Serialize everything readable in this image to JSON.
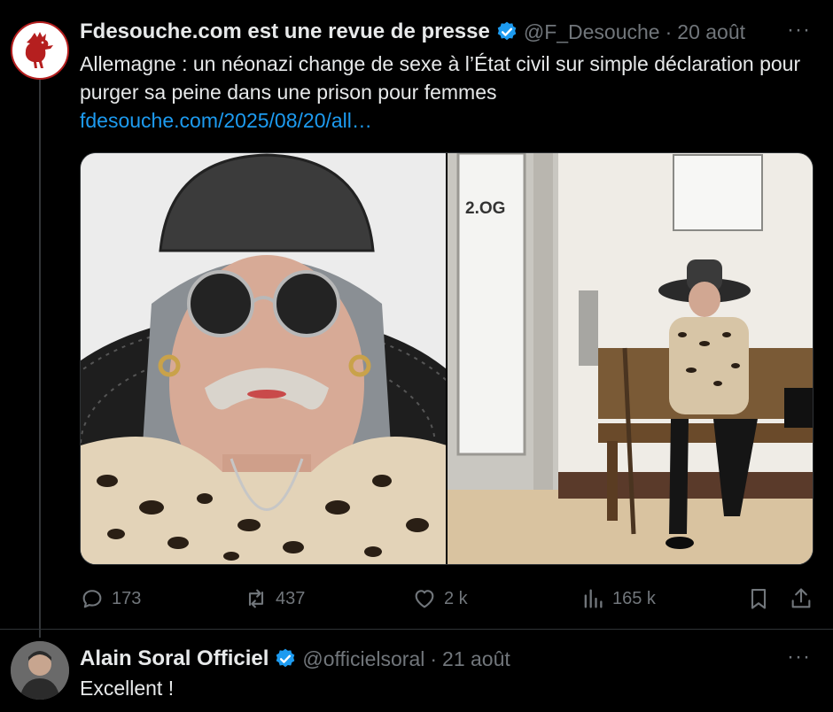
{
  "tweet1": {
    "author": "Fdesouche.com est une revue de presse",
    "handle": "@F_Desouche",
    "separator": "·",
    "date": "20 août",
    "text": "Allemagne : un néonazi change de sexe à l’État civil sur simple déclaration pour purger sa peine dans une prison pour femmes",
    "link": "fdesouche.com/2025/08/20/all…",
    "images": [
      {
        "sign": "2.OG"
      }
    ],
    "stats": {
      "replies": "173",
      "reposts": "437",
      "likes": "2 k",
      "views": "165 k"
    }
  },
  "tweet2": {
    "author": "Alain Soral Officiel",
    "handle": "@officielsoral",
    "separator": "·",
    "date": "21 août",
    "text": "Excellent !"
  },
  "more_label": "···",
  "colors": {
    "background": "#000000",
    "text": "#e7e9ea",
    "secondary": "#71767b",
    "link": "#1d9bf0",
    "verified": "#1d9bf0",
    "logo_red": "#b51f1f"
  }
}
